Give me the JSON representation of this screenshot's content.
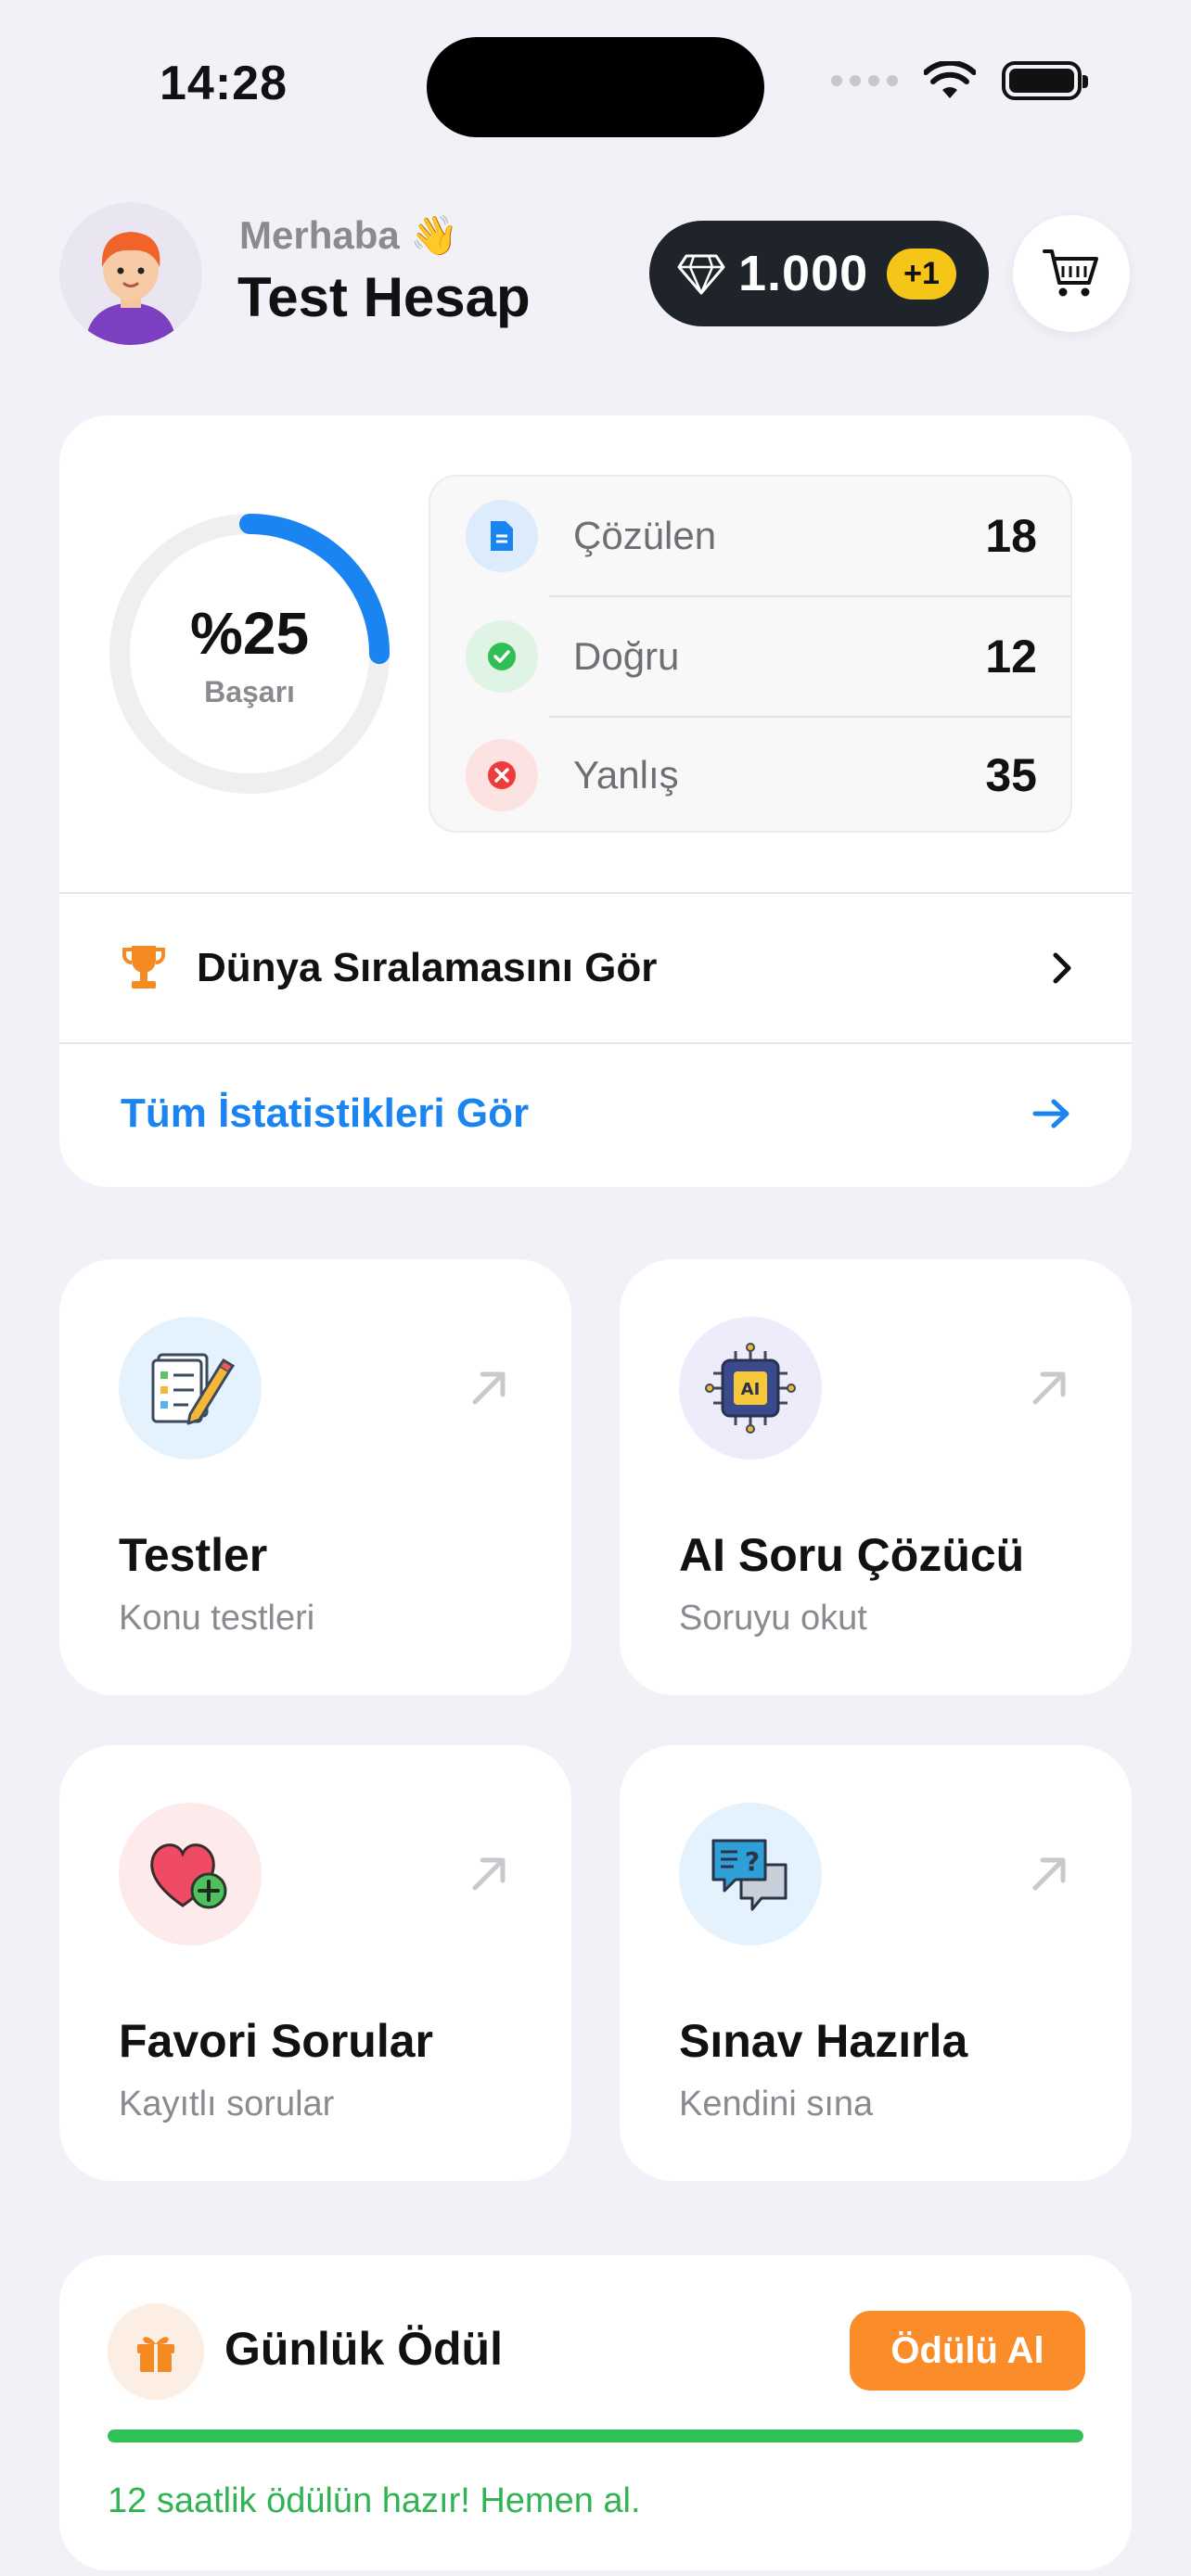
{
  "status_bar": {
    "time": "14:28"
  },
  "header": {
    "greeting": "Merhaba 👋",
    "username": "Test Hesap",
    "gems": "1.000",
    "gems_bonus": "+1"
  },
  "stats": {
    "success_percent": "%25",
    "success_value": 25,
    "success_label": "Başarı",
    "rows": [
      {
        "label": "Çözülen",
        "value": "18",
        "icon": "document-icon"
      },
      {
        "label": "Doğru",
        "value": "12",
        "icon": "check-badge-icon"
      },
      {
        "label": "Yanlış",
        "value": "35",
        "icon": "x-badge-icon"
      }
    ],
    "ranking_label": "Dünya Sıralamasını Gör",
    "all_stats_label": "Tüm İstatistikleri Gör"
  },
  "tiles": [
    {
      "title": "Testler",
      "subtitle": "Konu testleri",
      "icon": "test-clipboard-icon"
    },
    {
      "title": "AI Soru Çözücü",
      "subtitle": "Soruyu okut",
      "icon": "ai-chip-icon"
    },
    {
      "title": "Favori Sorular",
      "subtitle": "Kayıtlı sorular",
      "icon": "heart-plus-icon"
    },
    {
      "title": "Sınav Hazırla",
      "subtitle": "Kendini sına",
      "icon": "chat-question-icon"
    }
  ],
  "reward": {
    "title": "Günlük Ödül",
    "button": "Ödülü Al",
    "progress": 1.0,
    "message": "12 saatlik ödülün hazır! Hemen al."
  },
  "colors": {
    "accent_blue": "#1a84f0",
    "reward_green": "#30c156",
    "reward_orange": "#fb8c2a",
    "gem_badge_yellow": "#f5c518"
  }
}
